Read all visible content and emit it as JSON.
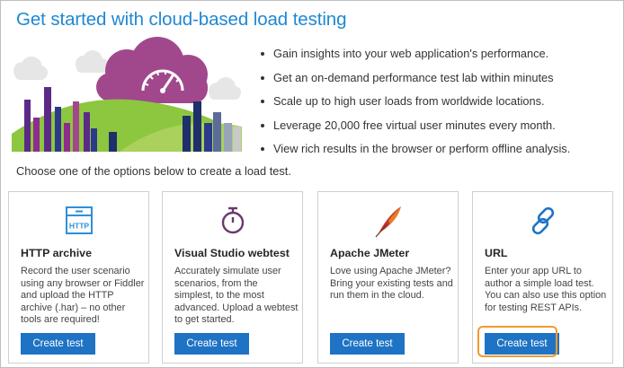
{
  "page": {
    "title": "Get started with cloud-based load testing",
    "bullets": [
      "Gain insights into your web application's performance.",
      "Get an on-demand performance test lab within minutes",
      "Scale up to high user loads from worldwide locations.",
      "Leverage 20,000 free virtual user minutes every month.",
      "View rich results in the browser or perform offline analysis."
    ],
    "choose_text": "Choose one of the options below to create a load test."
  },
  "cards": [
    {
      "title": "HTTP archive",
      "description": "Record the user scenario using any browser or Fiddler and upload the HTTP archive (.har) – no other tools are required!",
      "button": "Create test",
      "icon_label": "HTTP",
      "icon": "http-archive-icon"
    },
    {
      "title": "Visual Studio webtest",
      "description": "Accurately simulate user scenarios, from the simplest, to the most advanced. Upload a webtest to get started.",
      "button": "Create test",
      "icon": "stopwatch-icon"
    },
    {
      "title": "Apache JMeter",
      "description": "Love using Apache JMeter? Bring your existing tests and run them in the cloud.",
      "button": "Create test",
      "icon": "feather-icon"
    },
    {
      "title": "URL",
      "description": "Enter your app URL to author a simple load test. You can also use this option for testing REST APIs.",
      "button": "Create test",
      "icon": "link-icon",
      "highlighted": true
    }
  ],
  "colors": {
    "title": "#1e88d2",
    "button": "#1e73c4",
    "highlight": "#f29a2e",
    "cloud": "#a1488d",
    "hill": "#8dc63f",
    "http_icon": "#2e8fd8",
    "stopwatch_icon": "#6b3a6b",
    "feather_icon": "#c0392b",
    "link_icon": "#1e73c4"
  }
}
